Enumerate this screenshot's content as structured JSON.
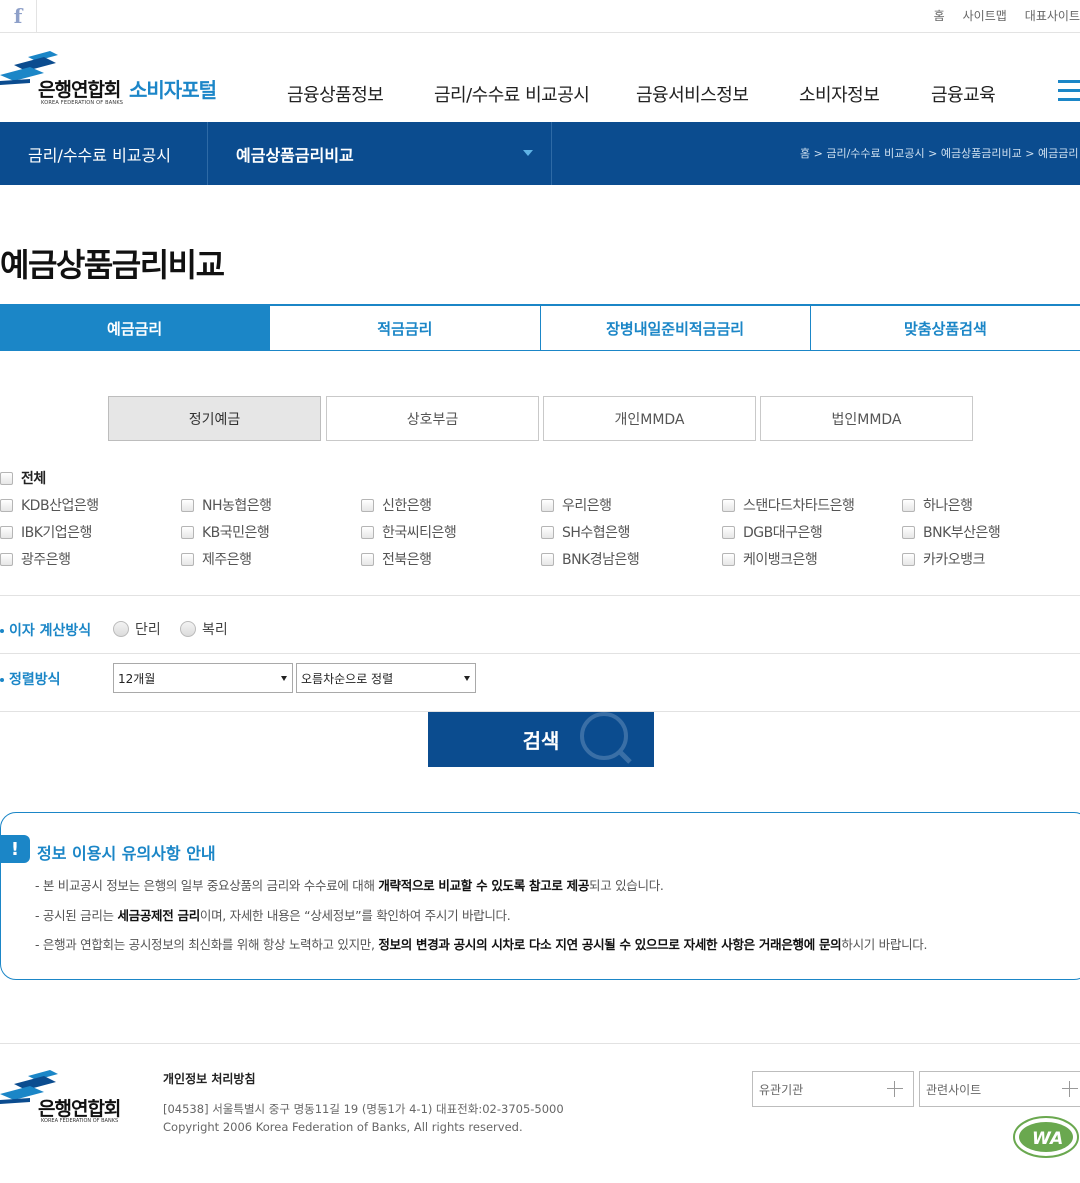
{
  "topbar": {
    "facebook_glyph": "f",
    "links": [
      "홈",
      "사이트맵",
      "대표사이트"
    ]
  },
  "header": {
    "logo_kr": "은행연합회",
    "logo_en": "KOREA FEDERATION OF BANKS",
    "portal": "소비자포털",
    "gnb": [
      "금융상품정보",
      "금리/수수료 비교공시",
      "금융서비스정보",
      "소비자정보",
      "금융교육"
    ]
  },
  "subnav": {
    "level1": "금리/수수료 비교공시",
    "level2": "예금상품금리비교",
    "breadcrumb": "홈 > 금리/수수료 비교공시 > 예금상품금리비교 > 예금금리"
  },
  "page": {
    "title": "예금상품금리비교"
  },
  "main_tabs": [
    {
      "label": "예금금리",
      "active": true
    },
    {
      "label": "적금금리",
      "active": false
    },
    {
      "label": "장병내일준비적금금리",
      "active": false
    },
    {
      "label": "맞춤상품검색",
      "active": false
    }
  ],
  "sub_tabs": [
    {
      "label": "정기예금",
      "active": true
    },
    {
      "label": "상호부금",
      "active": false
    },
    {
      "label": "개인MMDA",
      "active": false
    },
    {
      "label": "법인MMDA",
      "active": false
    }
  ],
  "banks": {
    "all_label": "전체",
    "rows": [
      [
        "KDB산업은행",
        "NH농협은행",
        "신한은행",
        "우리은행",
        "스탠다드차타드은행",
        "하나은행"
      ],
      [
        "IBK기업은행",
        "KB국민은행",
        "한국씨티은행",
        "SH수협은행",
        "DGB대구은행",
        "BNK부산은행"
      ],
      [
        "광주은행",
        "제주은행",
        "전북은행",
        "BNK경남은행",
        "케이뱅크은행",
        "카카오뱅크"
      ]
    ]
  },
  "interest": {
    "label": "이자 계산방식",
    "options": [
      "단리",
      "복리"
    ]
  },
  "sort": {
    "label": "정렬방식",
    "period": "12개월",
    "order": "오름차순으로 정렬"
  },
  "search": {
    "label": "검색"
  },
  "notice": {
    "icon": "!",
    "title": "정보 이용시 유의사항 안내",
    "line1_a": "- 본 비교공시 정보는 은행의 일부 중요상품의 금리와 수수료에 대해 ",
    "line1_b": "개략적으로 비교할 수 있도록 참고로 제공",
    "line1_c": "되고 있습니다.",
    "line2_a": "- 공시된 금리는 ",
    "line2_b": "세금공제전 금리",
    "line2_c": "이며, 자세한 내용은 “상세정보”를 확인하여 주시기 바랍니다.",
    "line3_a": "- 은행과 연합회는 공시정보의 최신화를 위해 항상 노력하고 있지만, ",
    "line3_b": "정보의 변경과 공시의 시차로 다소 지연 공시될 수 있으므로 자세한 사항은 거래은행에 문의",
    "line3_c": "하시기 바랍니다."
  },
  "footer": {
    "logo_kr": "은행연합회",
    "logo_en": "KOREA FEDERATION OF BANKS",
    "privacy": "개인정보 처리방침",
    "address": "[04538] 서울특별시 중구 명동11길 19 (명동1가 4-1)      대표전화:02-3705-5000",
    "copyright": "Copyright 2006 Korea Federation of Banks, All rights reserved.",
    "related1": "유관기관",
    "related2": "관련사이트",
    "wa_mark": "WA"
  },
  "colors": {
    "primary": "#1b86c7",
    "navy": "#0b4c8f"
  }
}
